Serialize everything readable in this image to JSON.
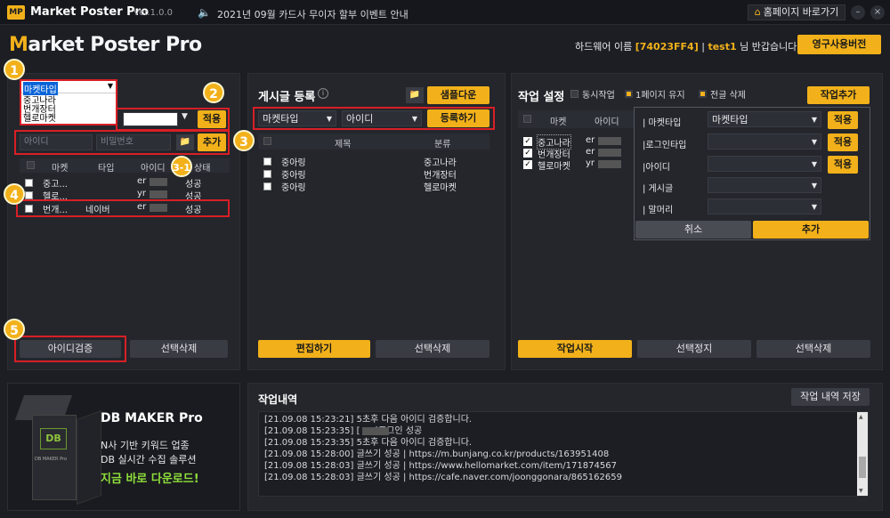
{
  "titlebar": {
    "logo": "MP",
    "title": "Market Poster Pro",
    "version": "Ver.1.0.0",
    "notice": "2021년 09월 카드사 무이자 할부 이벤트 안내",
    "home_button": "홈페이지 바로가기",
    "minimize": "–",
    "close": "×"
  },
  "brand": {
    "m": "M",
    "rest": "arket Poster Pro"
  },
  "header": {
    "greeting_prefix": "하드웨어 이름",
    "hw_id": "[74023FF4]",
    "user": "test1",
    "greeting_suffix": "님 반갑습니다!",
    "license_button": "영구사용버전"
  },
  "left": {
    "market_select": "마켓타입",
    "market_options": [
      "중고나라",
      "번개장터",
      "헬로마켓"
    ],
    "apply": "적용",
    "id_placeholder": "아이디",
    "pw_placeholder": "비밀번호",
    "add": "추가",
    "columns": [
      "마켓",
      "타입",
      "아이디",
      "상태"
    ],
    "rows": [
      {
        "market": "중고...",
        "type": "",
        "id": "er",
        "status": "성공"
      },
      {
        "market": "헬로...",
        "type": "",
        "id": "yr",
        "status": "성공"
      },
      {
        "market": "번개...",
        "type": "네이버",
        "id": "er",
        "status": "성공"
      }
    ],
    "verify": "아이디검증",
    "delete": "선택삭제"
  },
  "middle": {
    "title": "게시글 등록",
    "sample_download": "샘플다운",
    "market_select": "마켓타입",
    "id_select": "아이디",
    "register": "등록하기",
    "columns": [
      "제목",
      "분류"
    ],
    "rows": [
      {
        "title": "중아링",
        "category": "중고나라"
      },
      {
        "title": "중아링",
        "category": "번개장터"
      },
      {
        "title": "중아링",
        "category": "헬로마켓"
      }
    ],
    "edit": "편집하기",
    "delete": "선택삭제"
  },
  "right": {
    "title": "작업 설정",
    "opt_concurrent": "동시작업",
    "opt_page1": "1페이지 유지",
    "opt_delete_all": "전글 삭제",
    "add_job": "작업추가",
    "columns": [
      "마켓",
      "아이디"
    ],
    "rows": [
      {
        "market": "중고나라",
        "id": "er"
      },
      {
        "market": "번개장터",
        "id": "er"
      },
      {
        "market": "헬로마켓",
        "id": "yr"
      }
    ],
    "popup": {
      "fields": [
        {
          "label": "| 마켓타입",
          "value": "마켓타입",
          "apply": "적용"
        },
        {
          "label": "|로그인타입",
          "value": "",
          "apply": "적용"
        },
        {
          "label": "|아이디",
          "value": "",
          "apply": "적용"
        },
        {
          "label": "| 게시글",
          "value": ""
        },
        {
          "label": "| 말머리",
          "value": ""
        }
      ],
      "cancel": "취소",
      "add": "추가"
    },
    "start": "작업시작",
    "stop": "선택정지",
    "delete": "선택삭제"
  },
  "ad": {
    "box_brand": "DB MAKER Pro",
    "box_label": "DB",
    "headline": "DB MAKER Pro",
    "line1": "N사 기반 키워드 업종",
    "line2": "DB 실시간 수집 솔루션",
    "cta": "지금 바로 다운로드!"
  },
  "log": {
    "title": "작업내역",
    "save": "작업 내역 저장",
    "lines": [
      "[21.09.08 15:23:21]   5초후 다음 아이디 검증합니다.",
      "[21.09.08 15:23:35]   [ er           ]로그인 성공",
      "[21.09.08 15:23:35]   5초후 다음 아이디 검증합니다.",
      "[21.09.08 15:28:00]   글쓰기 성공 | https://m.bunjang.co.kr/products/163951408",
      "[21.09.08 15:28:03]   글쓰기 성공 | https://www.hellomarket.com/item/171874567",
      "[21.09.08 15:28:03]   글쓰기 성공 | https://cafe.naver.com/joonggonara/865162659"
    ]
  },
  "steps": [
    "1",
    "2",
    "3",
    "3-1",
    "4",
    "5"
  ],
  "colors": {
    "accent": "#f2b11a",
    "annotation": "#d81f26",
    "background": "#1c1e24"
  }
}
